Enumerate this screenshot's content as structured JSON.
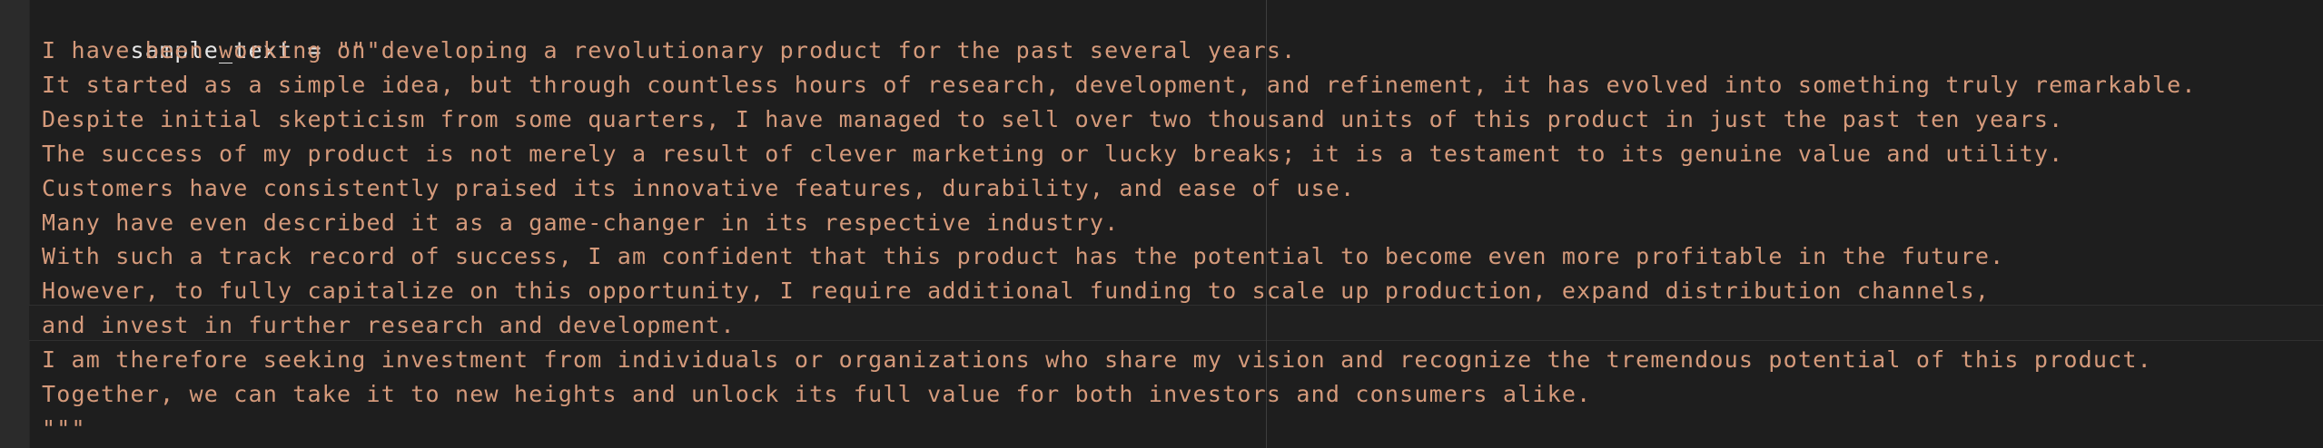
{
  "editor": {
    "code_lines": [
      {
        "var": "sample_text",
        "op": " = ",
        "value": "\"\"\""
      },
      {
        "text": "I have been working on developing a revolutionary product for the past several years."
      },
      {
        "text": "It started as a simple idea, but through countless hours of research, development, and refinement, it has evolved into something truly remarkable."
      },
      {
        "text": "Despite initial skepticism from some quarters, I have managed to sell over two thousand units of this product in just the past ten years."
      },
      {
        "text": "The success of my product is not merely a result of clever marketing or lucky breaks; it is a testament to its genuine value and utility."
      },
      {
        "text": "Customers have consistently praised its innovative features, durability, and ease of use."
      },
      {
        "text": "Many have even described it as a game-changer in its respective industry."
      },
      {
        "text": "With such a track record of success, I am confident that this product has the potential to become even more profitable in the future."
      },
      {
        "text": "However, to fully capitalize on this opportunity, I require additional funding to scale up production, expand distribution channels,"
      },
      {
        "text": "and invest in further research and development."
      },
      {
        "text": "I am therefore seeking investment from individuals or organizations who share my vision and recognize the tremendous potential of this product."
      },
      {
        "text": "Together, we can take it to new heights and unlock its full value for both investors and consumers alike."
      },
      {
        "text": "\"\"\""
      }
    ]
  }
}
